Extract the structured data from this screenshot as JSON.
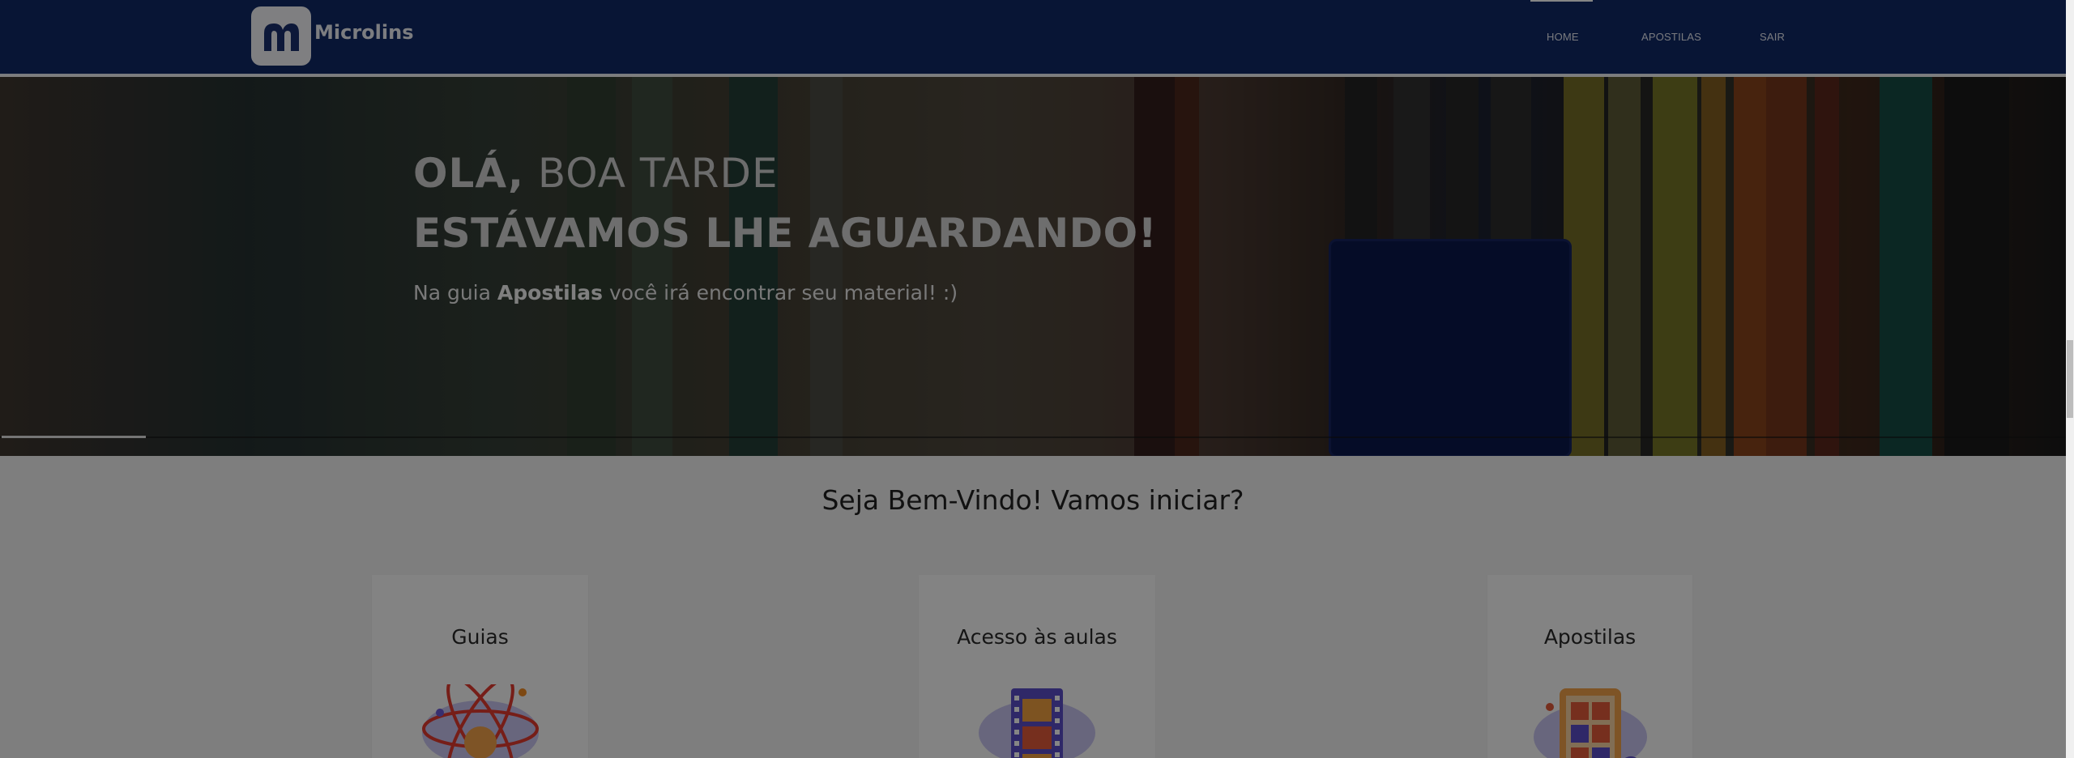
{
  "header": {
    "brand": "Microlins",
    "nav": [
      {
        "label": "HOME",
        "active": true
      },
      {
        "label": "APOSTILAS",
        "active": false
      },
      {
        "label": "SAIR",
        "active": false
      }
    ]
  },
  "hero": {
    "greeting_bold": "OLÁ,",
    "greeting_rest": " BOA TARDE",
    "headline": "ESTÁVAMOS LHE AGUARDANDO!",
    "sub_before": "Na guia ",
    "sub_bold": "Apostilas",
    "sub_after": " você irá encontrar seu material! :)"
  },
  "welcome": "Seja Bem-Vindo! Vamos iniciar?",
  "cards": [
    {
      "title": "Guias",
      "icon": "atom-wifi-icon"
    },
    {
      "title": "Acesso às aulas",
      "icon": "film-strip-icon"
    },
    {
      "title": "Apostilas",
      "icon": "tablet-content-icon"
    }
  ],
  "colors": {
    "header_bg": "#102a66",
    "page_bg": "#f2f2f2"
  }
}
